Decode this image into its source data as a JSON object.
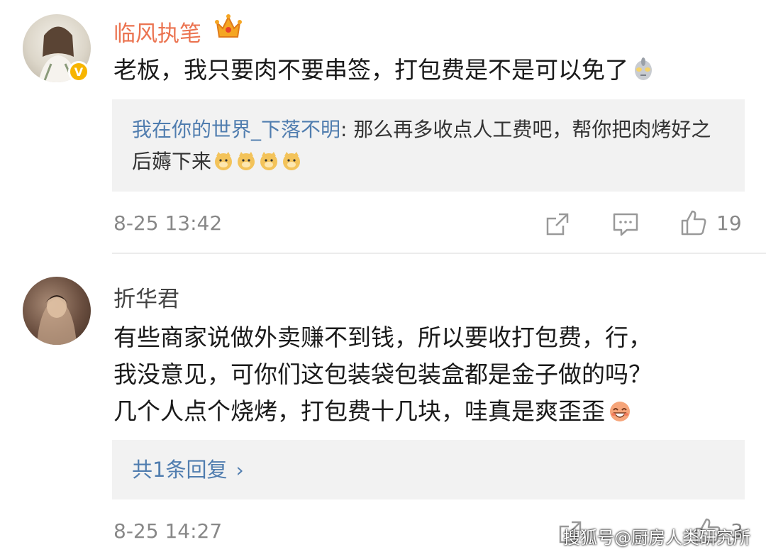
{
  "comments": [
    {
      "username": "临风执笔",
      "text": "老板，我只要肉不要串签，打包费是不是可以免了",
      "reply": {
        "user": "我在你的世界_下落不明",
        "colon": ": ",
        "text": "那么再多收点人工费吧，帮你把肉烤好之后薅下来"
      },
      "time": "8-25 13:42",
      "likes": "19"
    },
    {
      "username": "折华君",
      "text_lines": [
        "有些商家说做外卖赚不到钱，所以要收打包费，行，",
        "我没意见，可你们这包装袋包装盒都是金子做的吗？",
        "几个人点个烧烤，打包费十几块，哇真是爽歪歪"
      ],
      "more_replies": "共1条回复",
      "more_chevron": "›",
      "time": "8-25 14:27",
      "likes": "3"
    }
  ],
  "verified_badge": "V",
  "watermark": "搜狐号@厨房人类研究所",
  "colors": {
    "accent_username": "#eb7350",
    "link": "#507daf",
    "meta": "#888888",
    "reply_bg": "#f2f2f2"
  },
  "icons": [
    "crown-icon",
    "verified-icon",
    "ultraman-emoji",
    "doge-emoji",
    "laugh-emoji",
    "share-icon",
    "comment-icon",
    "like-icon"
  ]
}
